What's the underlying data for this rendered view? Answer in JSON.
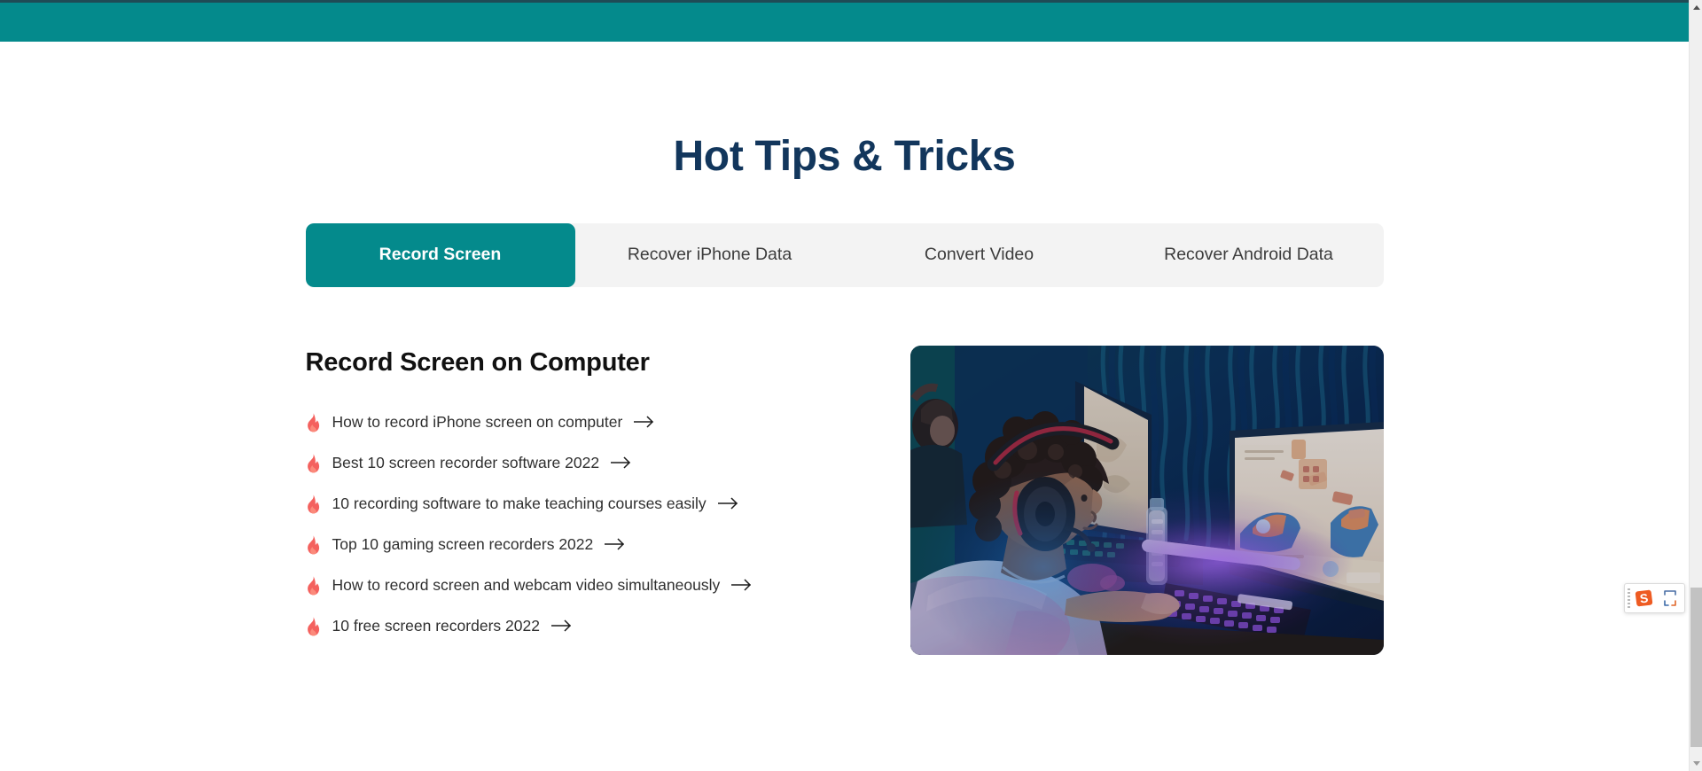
{
  "window": {
    "top_bar_color": "#048a8c"
  },
  "header": {
    "title": "Hot Tips & Tricks",
    "title_color": "#12365c"
  },
  "tabs": {
    "active_index": 0,
    "active_bg": "#048a8c",
    "bar_bg": "#f3f3f3",
    "items": [
      {
        "label": "Record Screen"
      },
      {
        "label": "Recover iPhone Data"
      },
      {
        "label": "Convert Video"
      },
      {
        "label": "Recover Android Data"
      }
    ]
  },
  "panel": {
    "heading": "Record Screen on Computer",
    "tips": [
      {
        "label": "How to record iPhone screen on computer"
      },
      {
        "label": "Best 10 screen recorder software 2022"
      },
      {
        "label": "10 recording software to make teaching courses easily"
      },
      {
        "label": "Top 10 gaming screen recorders 2022"
      },
      {
        "label": "How to record screen and webcam video simultaneously"
      },
      {
        "label": "10 free screen recorders 2022"
      }
    ],
    "flame_icon": "flame-icon",
    "flame_color": "#f4615e",
    "arrow_icon": "arrow-right-icon",
    "photo": {
      "alt": "Young person wearing headphones playing a game on a dual-monitor computer setup lit by blue and purple neon light",
      "icon": "gaming-setup-photo"
    }
  },
  "scrollbar": {
    "up_icon": "scroll-up-arrow-icon",
    "down_icon": "scroll-down-arrow-icon",
    "thumb_icon": "scrollbar-thumb"
  },
  "snipaste_widget": {
    "logo_icon": "snipaste-logo-icon",
    "logo_letter": "S",
    "expand_icon": "expand-icon",
    "grip_icon": "drag-grip-icon"
  }
}
